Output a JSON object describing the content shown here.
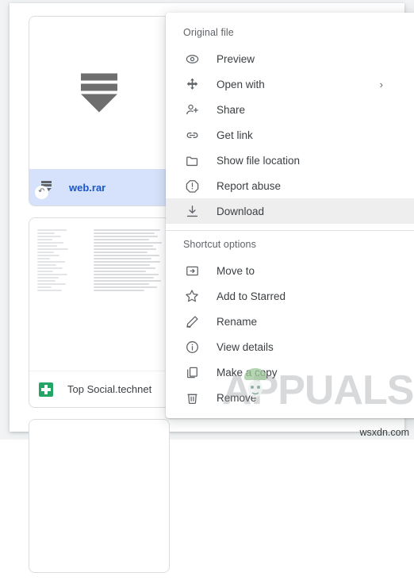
{
  "app": {
    "background_color": "#f1f3f4",
    "surface_color": "#ffffff"
  },
  "file_grid": {
    "cards": [
      {
        "name": "web.rar",
        "file_type": "rar-archive",
        "thumbnail": "rar-archive-glyph",
        "selected": true,
        "has_shortcut_badge": true,
        "badge_icon": "shortcut-arrow-icon",
        "selected_background": "#d6e2fb",
        "selected_text_color": "#1a56c7"
      },
      {
        "name": "Top Social.technet",
        "file_type": "google-sheets",
        "thumbnail": "spreadsheet-text-preview",
        "selected": false,
        "has_shortcut_badge": false,
        "icon_color": "#23a566"
      }
    ]
  },
  "context_menu": {
    "highlight_color": "#eeeeee",
    "sections": [
      {
        "header": "Original file",
        "items": [
          {
            "label": "Preview",
            "icon": "eye-icon",
            "highlighted": false,
            "has_submenu": false
          },
          {
            "label": "Open with",
            "icon": "open-with-arrows-icon",
            "highlighted": false,
            "has_submenu": true
          },
          {
            "label": "Share",
            "icon": "person-add-icon",
            "highlighted": false,
            "has_submenu": false
          },
          {
            "label": "Get link",
            "icon": "link-icon",
            "highlighted": false,
            "has_submenu": false
          },
          {
            "label": "Show file location",
            "icon": "folder-icon",
            "highlighted": false,
            "has_submenu": false
          },
          {
            "label": "Report abuse",
            "icon": "report-abuse-icon",
            "highlighted": false,
            "has_submenu": false
          },
          {
            "label": "Download",
            "icon": "download-icon",
            "highlighted": true,
            "has_submenu": false
          }
        ]
      },
      {
        "header": "Shortcut options",
        "items": [
          {
            "label": "Move to",
            "icon": "folder-move-icon",
            "highlighted": false,
            "has_submenu": false
          },
          {
            "label": "Add to Starred",
            "icon": "star-icon",
            "highlighted": false,
            "has_submenu": false
          },
          {
            "label": "Rename",
            "icon": "pencil-icon",
            "highlighted": false,
            "has_submenu": false
          },
          {
            "label": "View details",
            "icon": "info-circle-icon",
            "highlighted": false,
            "has_submenu": false
          },
          {
            "label": "Make a copy",
            "icon": "copy-icon",
            "highlighted": false,
            "has_submenu": false
          },
          {
            "label": "Remove",
            "icon": "trash-icon",
            "highlighted": false,
            "has_submenu": false
          }
        ]
      }
    ],
    "submenu_arrow_glyph": "›"
  },
  "watermarks": {
    "brand": "PPUALS",
    "brand_prefix": "A",
    "site": "wsxdn.com"
  }
}
